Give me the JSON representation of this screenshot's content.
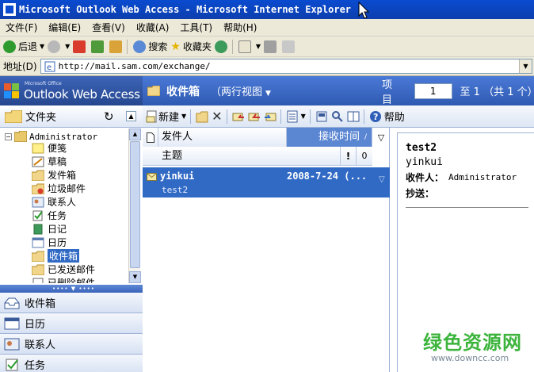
{
  "window": {
    "title": "Microsoft Outlook Web Access - Microsoft Internet Explorer"
  },
  "menu": [
    "文件(F)",
    "编辑(E)",
    "查看(V)",
    "收藏(A)",
    "工具(T)",
    "帮助(H)"
  ],
  "toolbar": {
    "back": "后退",
    "search": "搜索",
    "favorites": "收藏夹"
  },
  "address": {
    "label": "地址(D)",
    "url": "http://mail.sam.com/exchange/"
  },
  "owa": {
    "logo_small": "Microsoft Office",
    "logo_text": "Outlook Web Access",
    "folder_name": "收件箱",
    "view": "（两行视图",
    "paging_items": "项目",
    "paging_page": "1",
    "paging_total": "至 1 （共 1 个）"
  },
  "folders": {
    "header": "文件夹",
    "root": "Administrator",
    "items": [
      "便笺",
      "草稿",
      "发件箱",
      "垃圾邮件",
      "联系人",
      "任务",
      "日记",
      "日历",
      "收件箱",
      "已发送邮件",
      "已删除邮件"
    ],
    "selected": "收件箱"
  },
  "nav": [
    "收件箱",
    "日历",
    "联系人",
    "任务"
  ],
  "commands": {
    "new": "新建",
    "help": "帮助"
  },
  "list": {
    "col_from": "发件人",
    "col_received": "接收时间",
    "col_subject": "主题",
    "col_importance": "!",
    "col_attachment": "0",
    "messages": [
      {
        "sender": "yinkui",
        "date": "2008-7-24 (...",
        "subject": "test2"
      }
    ]
  },
  "reading": {
    "subject": "test2",
    "from": "yinkui",
    "to_label": "收件人：",
    "to_value": "Administrator",
    "cc_label": "抄送："
  },
  "watermark": {
    "cn": "绿色资源网",
    "url": "www.downcc.com"
  },
  "colors": {
    "accent": "#316ac5",
    "header": "#3d6bc4",
    "brand_green": "#3cb43c"
  }
}
